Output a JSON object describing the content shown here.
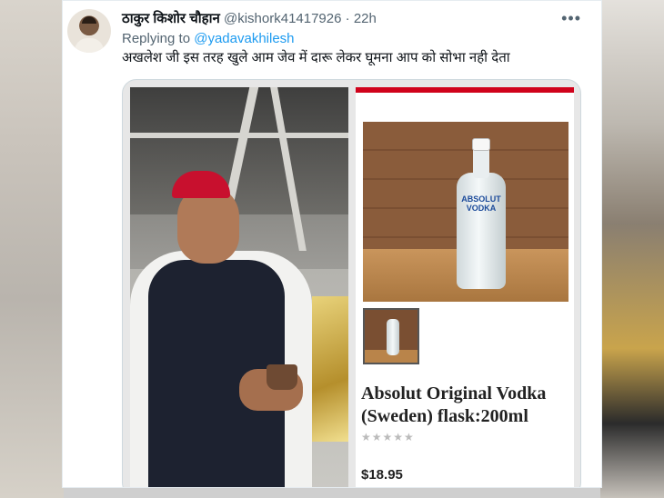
{
  "tweet": {
    "author_name": "ठाकुर किशोर चौहान",
    "author_handle": "@kishork41417926",
    "separator": "·",
    "timestamp": "22h",
    "more_icon": "more-horizontal-icon",
    "reply_prefix": "Replying to",
    "reply_to": "@yadavakhilesh",
    "text": "अखलेश जी इस तरह खुले आम जेव में दारू लेकर घूमना आप को सोभा नही देता"
  },
  "product": {
    "bottle_label": "ABSOLUT VODKA",
    "title_line1": "Absolut Original Vodka",
    "title_line2": "(Sweden) flask:200ml",
    "rating_stars": "★★★★★",
    "price": "$18.95"
  }
}
